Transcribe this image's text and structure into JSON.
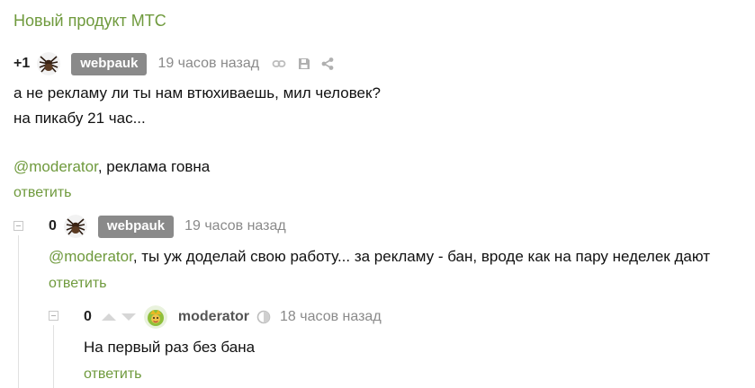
{
  "post": {
    "title": "Новый продукт МТС"
  },
  "comments": [
    {
      "rating": "+1",
      "author": "webpauk",
      "time": "19 часов назад",
      "lines": [
        "а не рекламу ли ты нам втюхиваешь, мил человек?",
        "на пикабу 21 час..."
      ],
      "mention": "@moderator",
      "mention_rest": ", реклама говна",
      "reply": "ответить",
      "icons": [
        "link-icon",
        "save-icon",
        "share-icon"
      ]
    },
    {
      "rating": "0",
      "author": "webpauk",
      "time": "19 часов назад",
      "mention": "@moderator",
      "text_rest": ", ты уж доделай свою работу... за рекламу - бан, вроде как на пару неделек дают",
      "reply": "ответить"
    },
    {
      "rating": "0",
      "author": "moderator",
      "time": "18 часов назад",
      "text": "На первый раз без бана",
      "reply": "ответить",
      "icons": [
        "vote-up-icon",
        "vote-down-icon",
        "moderator-badge-icon"
      ]
    }
  ],
  "colors": {
    "accent": "#6f9a3d",
    "badge": "#8a8a8a",
    "muted": "#8a8a8a"
  }
}
